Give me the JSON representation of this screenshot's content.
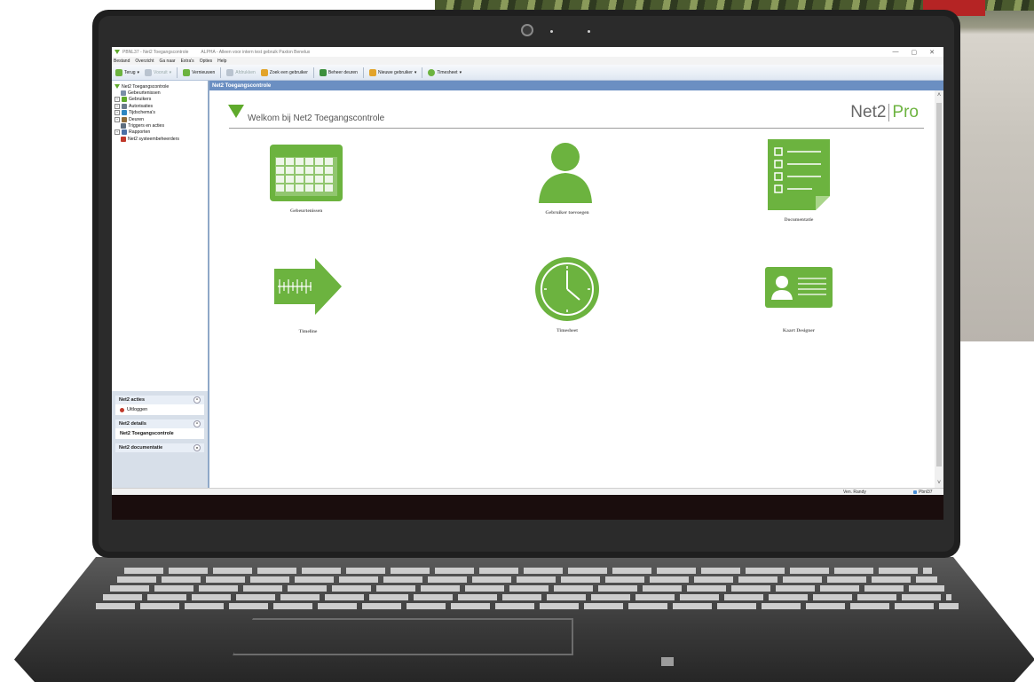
{
  "window": {
    "title": "PBNL37 - Net2 Toegangscontrole",
    "note": "ALPHA - Alleen voor intern test gebruik Paxton Benelux",
    "controls": [
      "—",
      "▢",
      "✕"
    ]
  },
  "menu": [
    "Bestand",
    "Overzicht",
    "Ga naar",
    "Extra's",
    "Opties",
    "Help"
  ],
  "toolbar": {
    "back": "Terug",
    "forward": "Vooruit",
    "refresh": "Vernieuwen",
    "print": "Afdrukken",
    "find_user": "Zoek een gebruiker",
    "manage_doors": "Beheer deuren",
    "new_user": "Nieuwe gebruiker",
    "timesheet": "Timesheet"
  },
  "tree": {
    "root": "Net2 Toegangscontrole",
    "items": [
      {
        "label": "Gebeurtenissen",
        "expandable": false,
        "color": "#7a8ea8"
      },
      {
        "label": "Gebruikers",
        "expandable": true,
        "color": "#5faa2c"
      },
      {
        "label": "Autorisaties",
        "expandable": true,
        "color": "#6b7b8c"
      },
      {
        "label": "Tijdschema's",
        "expandable": true,
        "color": "#2e86c1"
      },
      {
        "label": "Deuren",
        "expandable": true,
        "color": "#8e6b3a"
      },
      {
        "label": "Triggers en acties",
        "expandable": false,
        "color": "#5d6d7e"
      },
      {
        "label": "Rapporten",
        "expandable": true,
        "color": "#4a6fa5"
      },
      {
        "label": "Net2 systeembeheerders",
        "expandable": false,
        "color": "#c0392b"
      }
    ]
  },
  "panels": {
    "actions_title": "Net2 acties",
    "logout": "Uitloggen",
    "details_title": "Net2 details",
    "details_value": "Net2 Toegangscontrole",
    "docs_title": "Net2 documentatie"
  },
  "content": {
    "header": "Net2 Toegangscontrole",
    "welcome": "Welkom bij Net2 Toegangscontrole",
    "brand_left": "Net2",
    "brand_right": "Pro",
    "tiles": [
      "Gebeurtenissen",
      "Gebruiker toevoegen",
      "Documentatie",
      "Timeline",
      "Timesheet",
      "Kaart Designer"
    ]
  },
  "status": {
    "user": "Ven. Randy",
    "machine": "Pbnl37"
  },
  "colors": {
    "accent_green": "#6cb33f",
    "header_blue": "#6b8fc2"
  }
}
